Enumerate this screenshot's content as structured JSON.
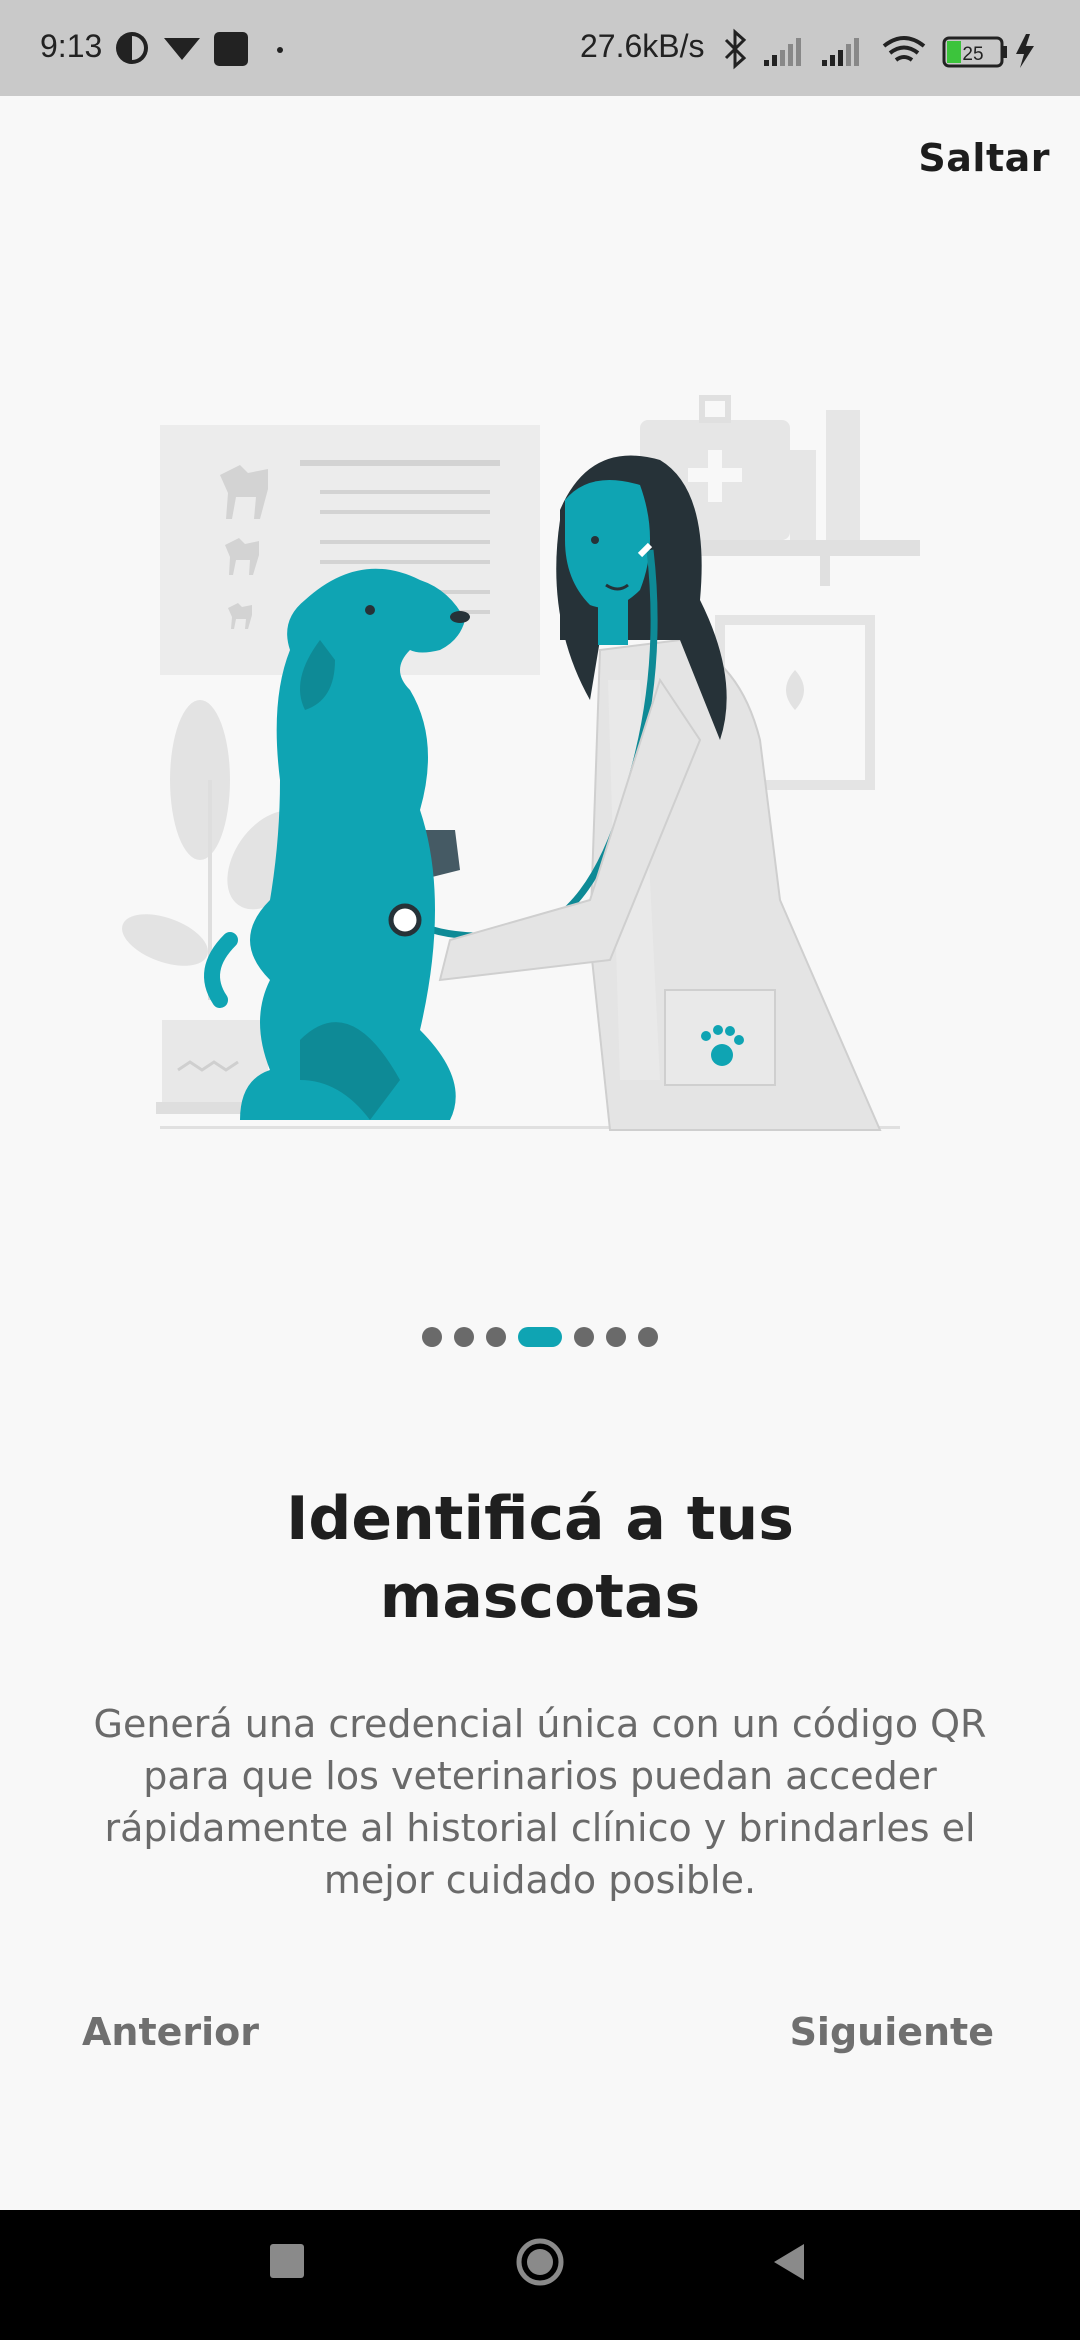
{
  "status_bar": {
    "time": "9:13",
    "net_rate": "27.6kB/s",
    "battery": "25",
    "icons": [
      "app-icon",
      "download-icon",
      "square-icon",
      "dot-icon",
      "bluetooth-icon",
      "signal-icon",
      "signal-icon",
      "wifi-icon",
      "battery-icon",
      "charging-icon"
    ]
  },
  "header": {
    "skip_label": "Saltar"
  },
  "onboarding": {
    "illustration": "veterinarian-examining-dog",
    "pager": {
      "total": 7,
      "current": 4
    },
    "title": "Identificá a tus mascotas",
    "description": "Generá una credencial única con un código QR para que los veterinarios puedan acceder rápidamente al historial clínico y brindarles el mejor cuidado posible."
  },
  "actions": {
    "previous_label": "Anterior",
    "next_label": "Siguiente"
  },
  "colors": {
    "accent": "#0fa4b3",
    "text_primary": "#1f1f1f",
    "text_secondary": "#6a6a6a",
    "background": "#f8f8f8"
  },
  "nav_bar": {
    "icons": [
      "recent-apps-icon",
      "home-icon",
      "back-icon"
    ]
  }
}
